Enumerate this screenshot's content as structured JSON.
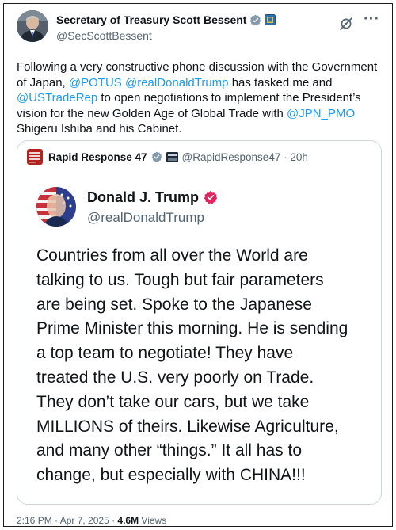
{
  "tweet": {
    "author_name": "Secretary of Treasury Scott Bessent",
    "author_handle": "@SecScottBessent",
    "text_parts": [
      "Following a very constructive phone discussion with the Government of Japan, ",
      "@POTUS",
      " ",
      "@realDonaldTrump",
      " has tasked me and ",
      "@USTradeRep",
      " to open negotiations to implement the President’s vision for the new Golden Age of Global Trade with ",
      "@JPN_PMO",
      " Shigeru Ishiba and his Cabinet."
    ],
    "timestamp": "2:16 PM · Apr 7, 2025 · ",
    "views_count": "4.6M",
    "views_label": " Views"
  },
  "quote": {
    "author_name": "Rapid Response 47",
    "meta": "@RapidResponse47 · 20h",
    "inner": {
      "author_name": "Donald J. Trump",
      "author_handle": "@realDonaldTrump",
      "lines": [
        "Countries from all over the World are",
        "talking to us. Tough but fair parameters",
        "are being set. Spoke to the Japanese",
        "Prime Minister this morning. He is sending",
        "a top team to negotiate! They have",
        "treated the U.S. very poorly on Trade.",
        "They don’t take our cars, but we take",
        "MILLIONS of theirs. Likewise Agriculture,",
        "and many other “things.” It all has to",
        "change, but especially with CHINA!!!"
      ]
    }
  },
  "icons": {
    "author_avatar": "avatar-photo",
    "verified_grey": "grey-checkmark-badge",
    "government_badge": "government-flag-badge",
    "grok": "grok-icon",
    "more": "more-options-icon",
    "verified_red": "red-checkmark-badge"
  },
  "colors": {
    "link": "#1d9bf0",
    "secondary_text": "#536471",
    "verified_grey": "#829aab",
    "verified_red": "#e0245e"
  }
}
